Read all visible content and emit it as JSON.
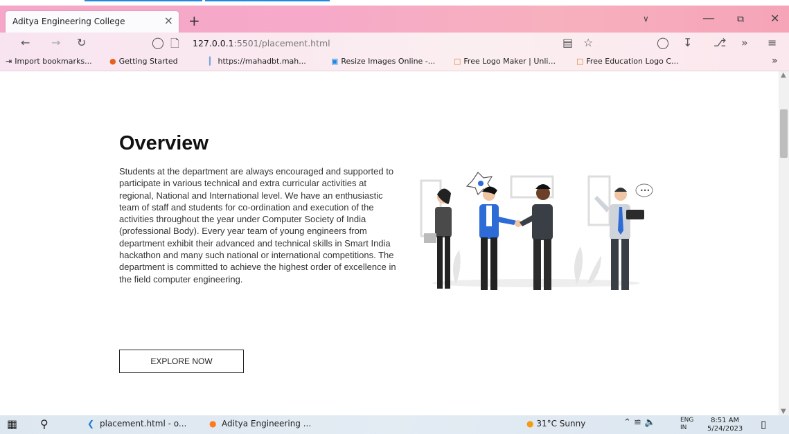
{
  "browser": {
    "tab_title": "Aditya Engineering College",
    "tab_close": "×",
    "new_tab": "+",
    "url_host": "127.0.0.1",
    "url_rest": ":5501/placement.html"
  },
  "bookmarks": [
    {
      "label": "Import bookmarks...",
      "icon": "import-icon"
    },
    {
      "label": "Getting Started",
      "icon": "firefox-icon"
    },
    {
      "label": "https://mahadbt.mah...",
      "icon": "page-icon"
    },
    {
      "label": "Resize Images Online -...",
      "icon": "image-icon"
    },
    {
      "label": "Free Logo Maker | Unli...",
      "icon": "logo-icon"
    },
    {
      "label": "Free Education Logo C...",
      "icon": "logo-icon"
    }
  ],
  "page": {
    "title": "Overview",
    "paragraph": "Students at the department are always encouraged and supported to participate in various technical and extra curricular activities at regional, National and International level. We have an enthusiastic team of staff and students for co-ordination and execution of the activities throughout the year under Computer Society of India (professional Body). Every year team of young engineers from department exhibit their advanced and technical skills in Smart India hackathon and many such national or international competitions. The department is committed to achieve the highest order of excellence in the field computer engineering.",
    "button": "EXPLORE NOW"
  },
  "taskbar": {
    "vscode": "placement.html - o...",
    "firefox": "Aditya Engineering ...",
    "weather": "31°C  Sunny",
    "lang": "ENG",
    "lang2": "IN",
    "time": "8:51 AM",
    "date": "5/24/2023"
  },
  "colors": {
    "titlebar_pink": "#f6a7c9",
    "accent_blue": "#1e88e5",
    "taskbar": "#dde7f0"
  }
}
